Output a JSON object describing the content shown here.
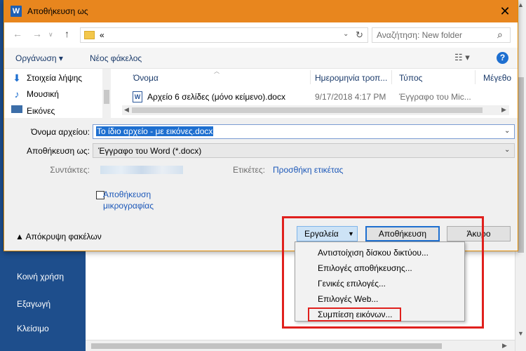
{
  "background": {
    "sidebar_items": [
      {
        "label": "Κοινή χρήση"
      },
      {
        "label": "Εξαγωγή"
      },
      {
        "label": "Κλείσιμο"
      }
    ]
  },
  "dialog": {
    "title": "Αποθήκευση ως",
    "close_glyph": "✕",
    "address": {
      "path": "«",
      "dropdown_glyph": "⌄",
      "refresh_glyph": "↻"
    },
    "search": {
      "placeholder": "Αναζήτηση: New folder"
    },
    "toolbar": {
      "organize": "Οργάνωση ▾",
      "new_folder": "Νέος φάκελος",
      "help": "?"
    },
    "nav_pane": {
      "items": [
        {
          "label": "Στοιχεία λήψης",
          "icon": "download-arrow-icon"
        },
        {
          "label": "Μουσική",
          "icon": "music-note-icon"
        },
        {
          "label": "Εικόνες",
          "icon": "pictures-icon"
        }
      ]
    },
    "file_list": {
      "columns": [
        "Όνομα",
        "Ημερομηνία τροπ...",
        "Τύπος",
        "Μέγεθο"
      ],
      "rows": [
        {
          "name": "Αρχείο 6 σελίδες (μόνο κείμενο).docx",
          "date": "9/17/2018 4:17 PM",
          "type": "Έγγραφο του Mic...",
          "size": ""
        }
      ]
    },
    "form": {
      "filename_label": "Όνομα αρχείου:",
      "filename_value": "Το ίδιο αρχείο - με εικόνες.docx",
      "savetype_label": "Αποθήκευση ως:",
      "savetype_value": "Έγγραφο του Word (*.docx)",
      "authors_label": "Συντάκτες:",
      "tags_label": "Ετικέτες:",
      "tags_link": "Προσθήκη ετικέτας",
      "thumbnail_line1": "Αποθήκευση",
      "thumbnail_line2": "μικρογραφίας"
    },
    "footer": {
      "hide_folders": "Απόκρυψη φακέλων",
      "tools": "Εργαλεία",
      "save": "Αποθήκευση",
      "cancel": "Άκυρο"
    },
    "tools_menu": {
      "items": [
        "Αντιστοίχιση δίσκου δικτύου...",
        "Επιλογές αποθήκευσης...",
        "Γενικές επιλογές...",
        "Επιλογές Web...",
        "Συμπίεση εικόνων..."
      ]
    }
  },
  "colors": {
    "titlebar": "#e8861e",
    "sidebar": "#1e4e8c",
    "highlight": "#e0201d",
    "selection": "#1e6fd0"
  }
}
